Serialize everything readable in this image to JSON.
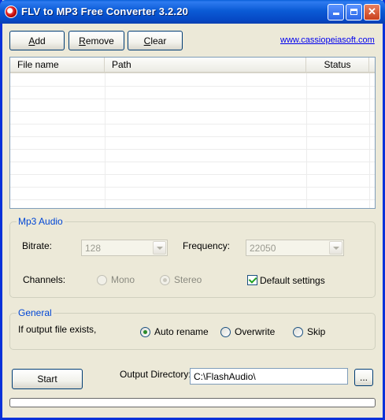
{
  "window": {
    "title": "FLV to MP3 Free Converter 3.2.20"
  },
  "toolbar": {
    "add_label": "Add",
    "add_underline": "A",
    "add_rest": "dd",
    "remove_underline": "R",
    "remove_rest": "emove",
    "clear_underline": "C",
    "clear_rest": "lear",
    "website_link": "www.cassiopeiasoft.com"
  },
  "file_list": {
    "columns": [
      "File name",
      "Path",
      "Status"
    ],
    "rows": []
  },
  "mp3_audio": {
    "legend": "Mp3 Audio",
    "bitrate_label": "Bitrate:",
    "bitrate_value": "128",
    "frequency_label": "Frequency:",
    "frequency_value": "22050",
    "channels_label": "Channels:",
    "mono_label": "Mono",
    "stereo_label": "Stereo",
    "stereo_selected": true,
    "default_settings_label": "Default settings",
    "default_settings_checked": true
  },
  "general": {
    "legend": "General",
    "exists_label": "If output file exists,",
    "options": [
      "Auto rename",
      "Overwrite",
      "Skip"
    ],
    "selected": "Auto rename"
  },
  "footer": {
    "start_label": "Start",
    "output_dir_label": "Output Directory:",
    "output_dir_value": "C:\\FlashAudio\\",
    "browse_label": "...",
    "progress": 0
  },
  "colors": {
    "legend": "#0046D5",
    "titlebar": "#0B5BD6",
    "link": "#0000EE"
  }
}
